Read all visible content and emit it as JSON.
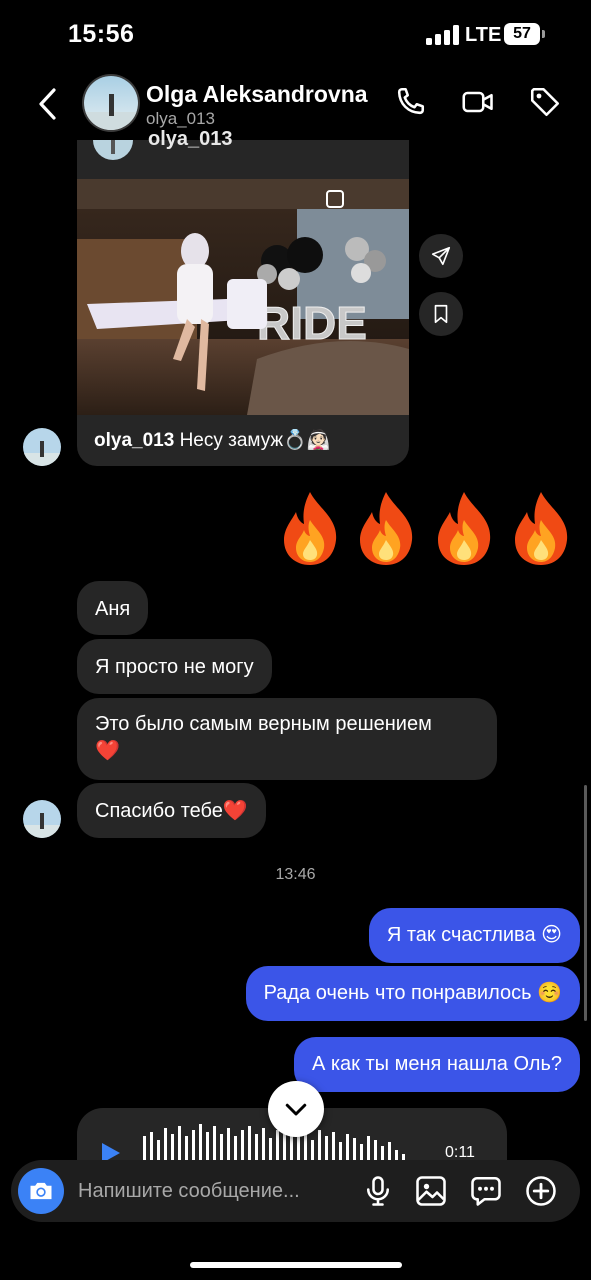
{
  "status": {
    "time": "15:56",
    "network": "LTE",
    "battery": "57"
  },
  "header": {
    "name": "Olga Aleksandrovna",
    "handle": "olya_013"
  },
  "post": {
    "top_handle": "olya_013",
    "author": "olya_013",
    "caption": "Несу замуж💍👰🏻"
  },
  "reaction_emojis": [
    "🔥",
    "🔥",
    "🔥",
    "🔥"
  ],
  "incoming": {
    "m1": "Аня",
    "m2": "Я просто не могу",
    "m3_line1": "Это было самым верным решением",
    "m3_line2": "❤️",
    "m4": "Спасибо тебе❤️"
  },
  "timestamp": "13:46",
  "outgoing": {
    "m1": "Я так счастлива 😍",
    "m2": "Рада очень что понравилось ☺️",
    "m3": "А как ты меня нашла Оль?"
  },
  "voice": {
    "duration": "0:11"
  },
  "composer": {
    "placeholder": "Напишите сообщение..."
  },
  "colors": {
    "accent": "#3b55e8",
    "bubble_in": "#262626",
    "camera": "#3b82f6"
  }
}
